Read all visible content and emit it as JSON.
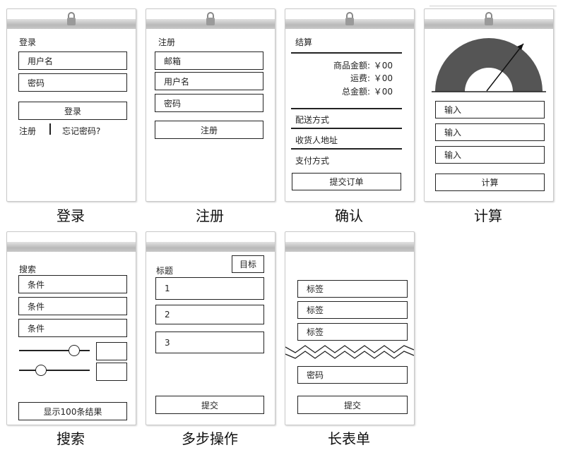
{
  "login": {
    "caption": "登录",
    "title": "登录",
    "username": "用户名",
    "password": "密码",
    "submit": "登录",
    "register_link": "注册",
    "forgot_link": "忘记密码?"
  },
  "register": {
    "caption": "注册",
    "title": "注册",
    "email": "邮箱",
    "username": "用户名",
    "password": "密码",
    "submit": "注册"
  },
  "confirm": {
    "caption": "确认",
    "title": "结算",
    "goods_label": "商品金额:",
    "goods_value": "￥00",
    "shipping_label": "运费:",
    "shipping_value": "￥00",
    "total_label": "总金额:",
    "total_value": "￥00",
    "delivery": "配送方式",
    "address": "收货人地址",
    "payment": "支付方式",
    "submit": "提交订单"
  },
  "calc": {
    "caption": "计算",
    "input1": "输入",
    "input2": "输入",
    "input3": "输入",
    "submit": "计算"
  },
  "search": {
    "caption": "搜索",
    "title": "搜索",
    "cond1": "条件",
    "cond2": "条件",
    "cond3": "条件",
    "slider1_value": 0.78,
    "slider2_value": 0.3,
    "submit": "显示100条结果"
  },
  "multistep": {
    "caption": "多步操作",
    "title": "标题",
    "goal": "目标",
    "step1": "1",
    "step2": "2",
    "step3": "3",
    "submit": "提交"
  },
  "longform": {
    "caption": "长表单",
    "tag1": "标签",
    "tag2": "标签",
    "tag3": "标签",
    "password": "密码",
    "submit": "提交"
  },
  "colors": {
    "gauge": "#555555",
    "line": "#222222",
    "bar": "#c4c4c4"
  }
}
